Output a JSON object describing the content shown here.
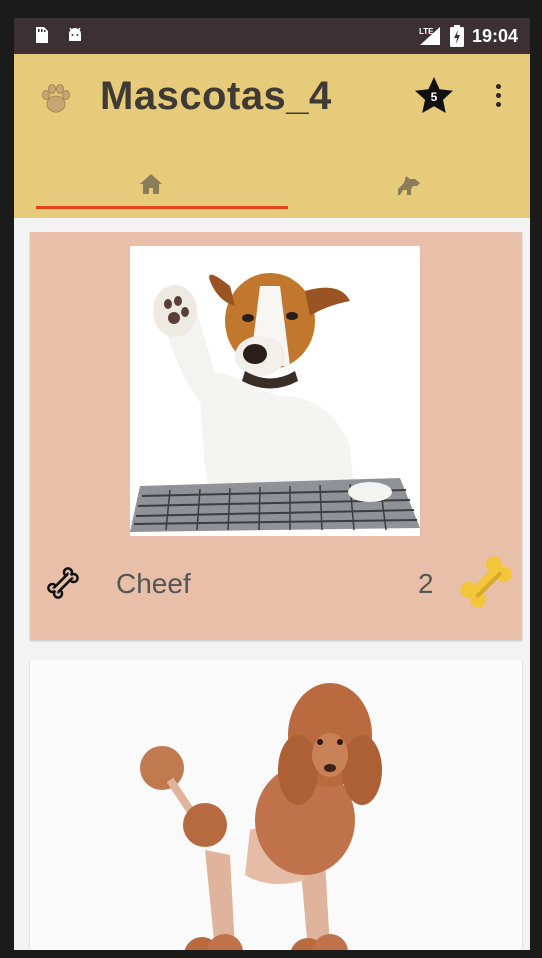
{
  "status_bar": {
    "time": "19:04",
    "network": "LTE",
    "left_icons": [
      "sd-card-icon",
      "android-icon"
    ],
    "right_icons": [
      "signal-icon",
      "battery-icon"
    ]
  },
  "app_bar": {
    "title": "Mascotas_4",
    "logo_icon": "paw-icon",
    "favorites_badge": "5",
    "action_icons": [
      "star-icon",
      "overflow-menu-icon"
    ],
    "background_color": "#e5cb7a"
  },
  "tabs": [
    {
      "icon": "home-icon",
      "selected": true
    },
    {
      "icon": "dog-icon",
      "selected": false
    }
  ],
  "tab_indicator_color": "#e8451f",
  "pets": [
    {
      "name": "Cheef",
      "rating": "2",
      "image": "dog-laptop-photo",
      "card_color": "#e8bfa9",
      "rate_icon": "bone-icon",
      "rating_icon": "golden-bone-icon"
    },
    {
      "name": "",
      "rating": "",
      "image": "poodle-photo",
      "card_color": "#fafafa"
    }
  ]
}
